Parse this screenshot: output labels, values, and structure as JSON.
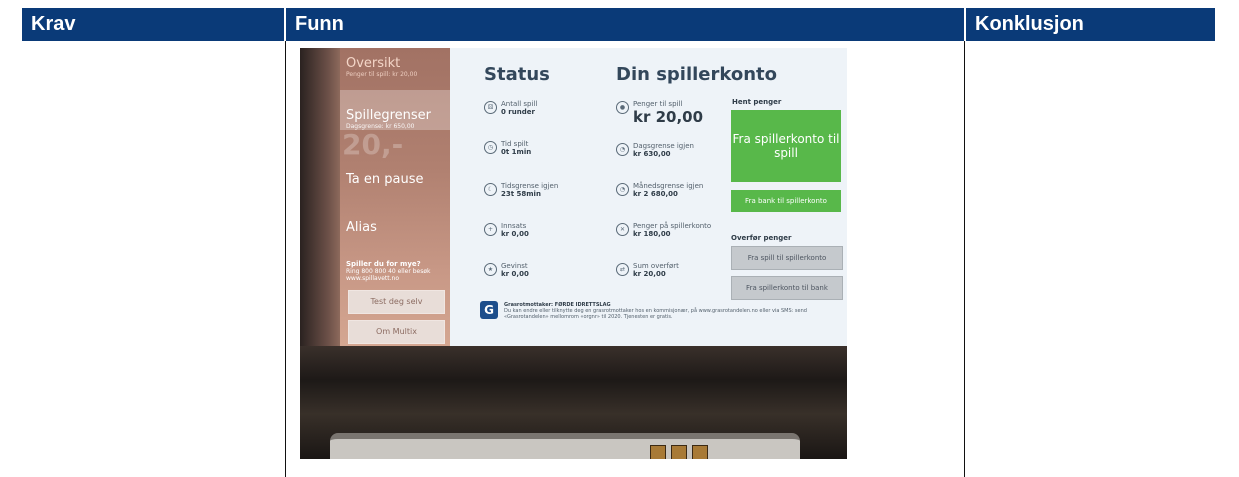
{
  "table": {
    "headers": [
      "Krav",
      "Funn",
      "Konklusjon"
    ]
  },
  "screen": {
    "sidebar": {
      "oversikt": "Oversikt",
      "oversikt_sub": "Penger til spill: kr 20,00",
      "spillegrenser": "Spillegrenser",
      "spillegrenser_sub": "Dagsgrense: kr 650,00",
      "pause": "Ta en pause",
      "alias": "Alias",
      "help_title": "Spiller du for mye?",
      "help_text": "Ring 800 800 40 eller besøk www.spillavett.no",
      "test_btn": "Test deg selv",
      "multix_btn": "Om Multix",
      "ghost": "20,-"
    },
    "status_title": "Status",
    "konto_title": "Din spillerkonto",
    "status": [
      {
        "label": "Antall spill",
        "value": "0 runder",
        "icon": "dice-icon"
      },
      {
        "label": "Tid spilt",
        "value": "0t 1min",
        "icon": "clock-icon"
      },
      {
        "label": "Tidsgrense igjen",
        "value": "23t 58min",
        "icon": "moon-icon"
      },
      {
        "label": "Innsats",
        "value": "kr 0,00",
        "icon": "coin-icon"
      },
      {
        "label": "Gevinst",
        "value": "kr 0,00",
        "icon": "star-icon"
      }
    ],
    "konto": [
      {
        "label": "Penger til spill",
        "value": "kr 20,00",
        "icon": "coin-icon"
      },
      {
        "label": "Dagsgrense igjen",
        "value": "kr 630,00",
        "icon": "pie-icon"
      },
      {
        "label": "Månedsgrense igjen",
        "value": "kr 2 680,00",
        "icon": "pie-icon"
      },
      {
        "label": "Penger på spillerkonto",
        "value": "kr 180,00",
        "icon": "cross-icon"
      },
      {
        "label": "Sum overført",
        "value": "kr 20,00",
        "icon": "transfer-icon"
      }
    ],
    "hent_label": "Hent penger",
    "btn_fra_konto": "Fra spillerkonto til spill",
    "btn_fra_bank": "Fra bank til spillerkonto",
    "overfor_label": "Overfør penger",
    "btn_spill_konto": "Fra spill til spillerkonto",
    "btn_konto_bank": "Fra spillerkonto til bank",
    "footer_title": "Grasrotmottaker: FØRDE IDRETTSLAG",
    "footer_text": "Du kan endre eller tilknytte deg en grasrotmottaker hos en kommisjonær, på www.grasrotandelen.no eller via SMS: send «Grasrotandelen» mellomrom «orgnr» til 2020. Tjenesten er gratis.",
    "logo": "G"
  }
}
